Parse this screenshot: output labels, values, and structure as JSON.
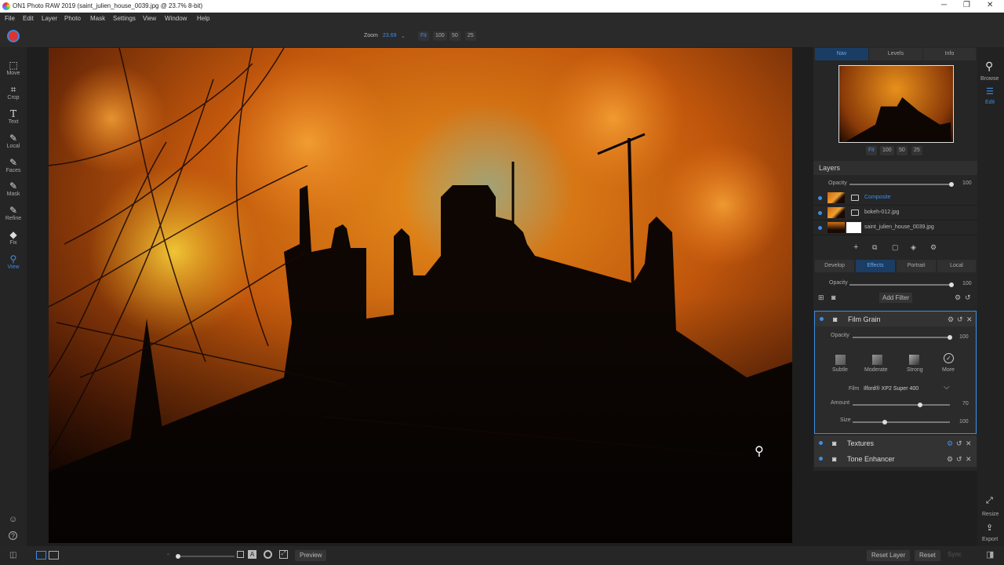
{
  "window": {
    "title": "ON1 Photo RAW 2019 (saint_julien_house_0039.jpg @ 23.7% 8-bit)"
  },
  "menu": [
    "File",
    "Edit",
    "Layer",
    "Photo",
    "Mask",
    "Settings",
    "View",
    "Window",
    "Help"
  ],
  "zoom": {
    "label": "Zoom",
    "value": "23.69",
    "buttons": [
      "Fit",
      "100",
      "50",
      "25"
    ]
  },
  "tools": [
    {
      "label": "Move",
      "icon": "move-icon"
    },
    {
      "label": "Crop",
      "icon": "crop-icon"
    },
    {
      "label": "Text",
      "icon": "text-icon"
    },
    {
      "label": "Local",
      "icon": "brush-icon"
    },
    {
      "label": "Faces",
      "icon": "faces-icon"
    },
    {
      "label": "Mask",
      "icon": "mask-brush-icon"
    },
    {
      "label": "Refine",
      "icon": "refine-icon"
    },
    {
      "label": "Fix",
      "icon": "fix-icon"
    },
    {
      "label": "View",
      "icon": "zoom-icon"
    }
  ],
  "nav": {
    "tabs": [
      "Nav",
      "Levels",
      "Info"
    ],
    "zoom_buttons": [
      "Fit",
      "100",
      "50",
      "25"
    ]
  },
  "layers": {
    "title": "Layers",
    "opacity_label": "Opacity",
    "opacity_value": "100",
    "opacity_level": 1.0,
    "items": [
      "Composite",
      "bokeh-012.jpg",
      "saint_julien_house_0039.jpg"
    ]
  },
  "modules": {
    "tabs": [
      "Develop",
      "Effects",
      "Portrait",
      "Local"
    ],
    "opacity_label": "Opacity",
    "opacity_value": "100",
    "add_filter": "Add Filter"
  },
  "film_grain": {
    "title": "Film Grain",
    "opacity_label": "Opacity",
    "opacity_value": "100",
    "presets": [
      "Subtle",
      "Moderate",
      "Strong",
      "More"
    ],
    "film_label": "Film",
    "film_value": "Ilford® XP2 Super 400",
    "amount_label": "Amount",
    "amount_value": "70",
    "size_label": "Size",
    "size_value": "100"
  },
  "filters": [
    "Textures",
    "Tone Enhancer"
  ],
  "right_strip": {
    "browse": "Browse",
    "edit": "Edit",
    "resize": "Resize",
    "export": "Export"
  },
  "bottom": {
    "preview": "Preview",
    "reset_layer": "Reset Layer",
    "reset": "Reset",
    "sync": "Sync"
  },
  "colors": {
    "accent": "#3a8ee6",
    "panel": "#262626"
  }
}
